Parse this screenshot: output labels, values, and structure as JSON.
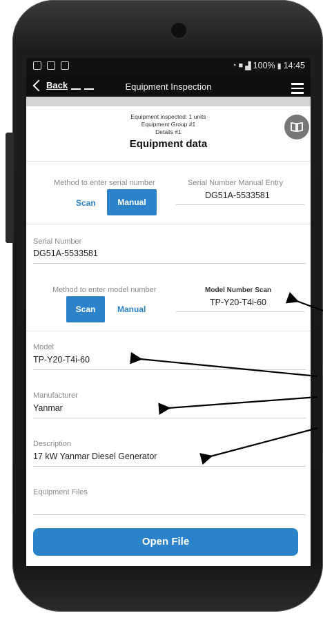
{
  "status": {
    "signal_text": "100%",
    "time": "14:45"
  },
  "toolbar": {
    "back_label": "Back",
    "title": "Equipment Inspection"
  },
  "header": {
    "line1": "Equipment inspected: 1 units",
    "line2": "Equipment Group #1",
    "line3": "Details #1",
    "title": "Equipment data"
  },
  "serial_method": {
    "label": "Method to enter serial number",
    "scan": "Scan",
    "manual": "Manual",
    "selected": "Manual"
  },
  "serial_manual_entry": {
    "label": "Serial Number Manual Entry",
    "value": "DG51A-5533581"
  },
  "serial_number": {
    "label": "Serial Number",
    "value": "DG51A-5533581"
  },
  "model_method": {
    "label": "Method to enter model number",
    "scan": "Scan",
    "manual": "Manual",
    "selected": "Scan"
  },
  "model_scan": {
    "label": "Model Number Scan",
    "value": "TP-Y20-T4i-60"
  },
  "model": {
    "label": "Model",
    "value": "TP-Y20-T4i-60"
  },
  "manufacturer": {
    "label": "Manufacturer",
    "value": "Yanmar"
  },
  "description": {
    "label": "Description",
    "value": "17 kW Yanmar Diesel Generator"
  },
  "equipment_files": {
    "label": "Equipment Files"
  },
  "open_file": {
    "label": "Open File"
  },
  "colors": {
    "accent": "#2d83c9",
    "toolbar": "#0f0f0f"
  }
}
